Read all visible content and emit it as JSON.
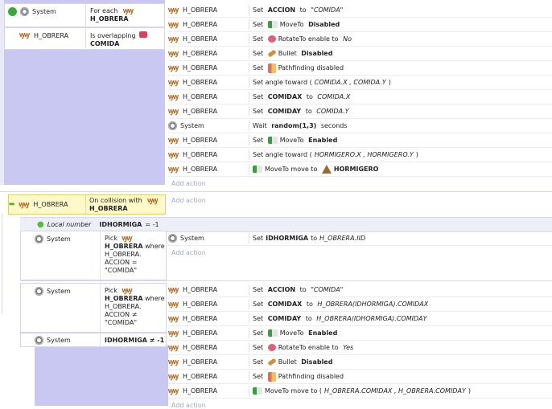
{
  "ev1": {
    "cond1_obj": "System",
    "cond1_text": "For each",
    "cond1_target": "H_OBRERA",
    "cond2_obj": "H_OBRERA",
    "cond2_text": "Is overlapping",
    "cond2_target": "COMIDA",
    "actions": [
      {
        "obj": "H_OBRERA",
        "icon": "worker-icon",
        "pre": "Set ",
        "bold": "ACCION",
        "mid": " to ",
        "ital": "\"COMIDA\"",
        "post": ""
      },
      {
        "obj": "H_OBRERA",
        "icon": "worker-icon",
        "act_icon": "moveto-icon",
        "pre": "Set ",
        "mid2": "MoveTo ",
        "bold": "Disabled"
      },
      {
        "obj": "H_OBRERA",
        "icon": "worker-icon",
        "act_icon": "rotateto-icon",
        "pre": "Set ",
        "mid2": "RotateTo enable to ",
        "ital": "No"
      },
      {
        "obj": "H_OBRERA",
        "icon": "worker-icon",
        "act_icon": "bullet-icon",
        "pre": "Set ",
        "mid2": "Bullet ",
        "bold": "Disabled"
      },
      {
        "obj": "H_OBRERA",
        "icon": "worker-icon",
        "act_icon": "pathfinding-icon",
        "pre": "Set ",
        "mid2": "Pathfinding disabled"
      },
      {
        "obj": "H_OBRERA",
        "icon": "worker-icon",
        "pre": "Set angle toward (",
        "ital": "COMIDA.X , COMIDA.Y",
        "post": ")"
      },
      {
        "obj": "H_OBRERA",
        "icon": "worker-icon",
        "pre": "Set ",
        "bold": "COMIDAX",
        "mid": " to ",
        "ital": "COMIDA.X"
      },
      {
        "obj": "H_OBRERA",
        "icon": "worker-icon",
        "pre": "Set ",
        "bold": "COMIDAY",
        "mid": " to ",
        "ital": "COMIDA.Y"
      },
      {
        "obj": "System",
        "icon": "gear-icon",
        "pre": "Wait ",
        "bold": "random(1,3)",
        "mid": " seconds"
      },
      {
        "obj": "H_OBRERA",
        "icon": "worker-icon",
        "act_icon": "moveto-icon",
        "pre": "Set ",
        "mid2": "MoveTo ",
        "bold": "Enabled"
      },
      {
        "obj": "H_OBRERA",
        "icon": "worker-icon",
        "pre": "Set angle toward (",
        "ital": "HORMIGERO.X , HORMIGERO.Y",
        "post": ")"
      },
      {
        "obj": "H_OBRERA",
        "icon": "worker-icon",
        "act_icon": "moveto-icon",
        "mid2": "MoveTo move to ",
        "act_icon2": "anthill-icon",
        "bold": "HORMIGERO"
      }
    ],
    "add_action": "Add action"
  },
  "ev2": {
    "obj": "H_OBRERA",
    "text": "On collision with",
    "target": "H_OBRERA",
    "add_action": "Add action",
    "local_label": "Local number",
    "local_name": "IDHORMIGA",
    "local_value": "= -1"
  },
  "sub1": {
    "obj": "System",
    "cond_pick": "Pick",
    "cond_target": "H_OBRERA",
    "cond_where": "where",
    "cond_expr1": "H_OBRERA.",
    "cond_expr2": "ACCION =",
    "cond_expr3": "\"COMIDA\"",
    "action_obj": "System",
    "action_pre": "Set ",
    "action_bold": "IDHORMIGA",
    "action_mid": " to ",
    "action_ital": "H_OBRERA.IID",
    "add_action": "Add action"
  },
  "sub2": {
    "obj": "System",
    "cond_pick": "Pick",
    "cond_target": "H_OBRERA",
    "cond_where": "where",
    "cond_expr1": "H_OBRERA.",
    "cond_expr2": "ACCION ≠",
    "cond_expr3": "\"COMIDA\"",
    "cond2_obj": "System",
    "cond2_text": "IDHORMIGA ≠ -1",
    "actions": [
      {
        "obj": "H_OBRERA",
        "pre": "Set ",
        "bold": "ACCION",
        "mid": " to ",
        "ital": "\"COMIDA\""
      },
      {
        "obj": "H_OBRERA",
        "pre": "Set ",
        "bold": "COMIDAX",
        "mid": " to ",
        "ital": "H_OBRERA(IDHORMIGA).COMIDAX"
      },
      {
        "obj": "H_OBRERA",
        "pre": "Set ",
        "bold": "COMIDAY",
        "mid": " to ",
        "ital": "H_OBRERA(IDHORMIGA).COMIDAY"
      },
      {
        "obj": "H_OBRERA",
        "act_icon": "moveto-icon",
        "pre": "Set ",
        "mid2": "MoveTo ",
        "bold": "Enabled"
      },
      {
        "obj": "H_OBRERA",
        "act_icon": "rotateto-icon",
        "pre": "Set ",
        "mid2": "RotateTo enable to ",
        "ital": "Yes"
      },
      {
        "obj": "H_OBRERA",
        "act_icon": "bullet-icon",
        "pre": "Set ",
        "mid2": "Bullet ",
        "bold": "Disabled"
      },
      {
        "obj": "H_OBRERA",
        "act_icon": "pathfinding-icon",
        "pre": "Set ",
        "mid2": "Pathfinding disabled"
      },
      {
        "obj": "H_OBRERA",
        "act_icon": "moveto-icon",
        "mid2": "MoveTo move to (",
        "ital": "H_OBRERA.COMIDAX , H_OBRERA.COMIDAY",
        "post": ")"
      }
    ],
    "add_action": "Add action"
  },
  "colors": {
    "lavender": "#c8c8f2",
    "highlight": "#fff8c8",
    "link": "#9fa8d2",
    "worker": "#b5651d"
  }
}
